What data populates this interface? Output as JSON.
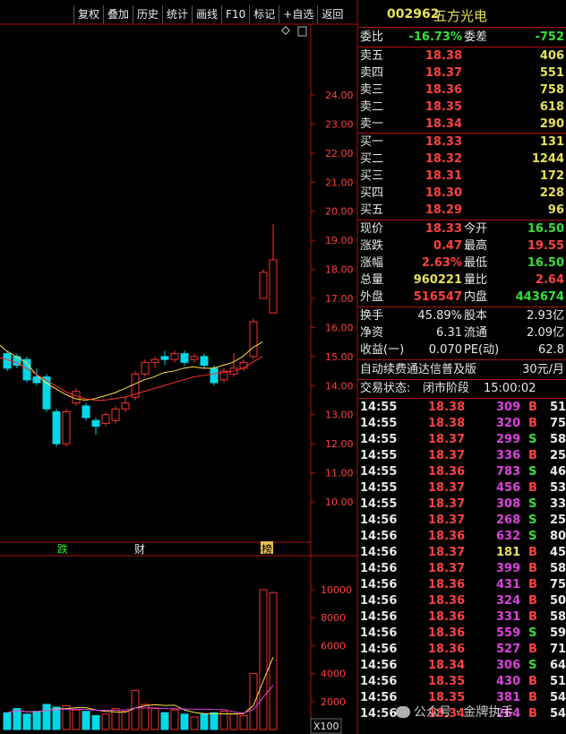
{
  "toolbar": {
    "buttons": [
      "复权",
      "叠加",
      "历史",
      "统计",
      "画线",
      "F10",
      "标记",
      "+自选",
      "返回"
    ]
  },
  "quote": {
    "code": "002962",
    "name": "五方光电",
    "weibi_label": "委比",
    "weibi_value": "-16.73%",
    "weicha_label": "委差",
    "weicha_value": "-752",
    "asks": [
      {
        "label": "卖五",
        "price": "18.38",
        "vol": "406"
      },
      {
        "label": "卖四",
        "price": "18.37",
        "vol": "551"
      },
      {
        "label": "卖三",
        "price": "18.36",
        "vol": "758"
      },
      {
        "label": "卖二",
        "price": "18.35",
        "vol": "618"
      },
      {
        "label": "卖一",
        "price": "18.34",
        "vol": "290"
      }
    ],
    "bids": [
      {
        "label": "买一",
        "price": "18.33",
        "vol": "131"
      },
      {
        "label": "买二",
        "price": "18.32",
        "vol": "1244"
      },
      {
        "label": "买三",
        "price": "18.31",
        "vol": "172"
      },
      {
        "label": "买四",
        "price": "18.30",
        "vol": "228"
      },
      {
        "label": "买五",
        "price": "18.29",
        "vol": "96"
      }
    ],
    "stats": [
      {
        "l1": "现价",
        "v1": "18.33",
        "c1": "red",
        "l2": "今开",
        "v2": "16.50",
        "c2": "green"
      },
      {
        "l1": "涨跌",
        "v1": "0.47",
        "c1": "red",
        "l2": "最高",
        "v2": "19.55",
        "c2": "red"
      },
      {
        "l1": "涨幅",
        "v1": "2.63%",
        "c1": "red",
        "l2": "最低",
        "v2": "16.50",
        "c2": "green"
      },
      {
        "l1": "总量",
        "v1": "960221",
        "c1": "yel",
        "l2": "量比",
        "v2": "2.64",
        "c2": "red"
      },
      {
        "l1": "外盘",
        "v1": "516547",
        "c1": "red",
        "l2": "内盘",
        "v2": "443674",
        "c2": "green"
      }
    ],
    "stats2": [
      {
        "l1": "换手",
        "v1": "45.89%",
        "l2": "股本",
        "v2": "2.93亿"
      },
      {
        "l1": "净资",
        "v1": "6.31",
        "l2": "流通",
        "v2": "2.09亿"
      },
      {
        "l1": "收益(一)",
        "v1": "0.070",
        "l2": "PE(动)",
        "v2": "62.8"
      }
    ],
    "promo": "自动续费通达信普及版",
    "promo_price": "30元/月",
    "status_label": "交易状态:",
    "status_value": "闭市阶段",
    "status_time": "15:00:02"
  },
  "ticks": [
    {
      "t": "14:55",
      "p": "18.38",
      "v": "309",
      "s": "B",
      "n": "51"
    },
    {
      "t": "14:55",
      "p": "18.38",
      "v": "320",
      "s": "B",
      "n": "75"
    },
    {
      "t": "14:55",
      "p": "18.37",
      "v": "299",
      "s": "S",
      "n": "58"
    },
    {
      "t": "14:55",
      "p": "18.37",
      "v": "336",
      "s": "B",
      "n": "25"
    },
    {
      "t": "14:55",
      "p": "18.36",
      "v": "783",
      "s": "S",
      "n": "46"
    },
    {
      "t": "14:55",
      "p": "18.37",
      "v": "456",
      "s": "B",
      "n": "53"
    },
    {
      "t": "14:55",
      "p": "18.37",
      "v": "308",
      "s": "S",
      "n": "33"
    },
    {
      "t": "14:56",
      "p": "18.37",
      "v": "268",
      "s": "S",
      "n": "25"
    },
    {
      "t": "14:56",
      "p": "18.36",
      "v": "632",
      "s": "S",
      "n": "80"
    },
    {
      "t": "14:56",
      "p": "18.37",
      "v": "181",
      "s": "B",
      "n": "45"
    },
    {
      "t": "14:56",
      "p": "18.37",
      "v": "399",
      "s": "B",
      "n": "58"
    },
    {
      "t": "14:56",
      "p": "18.36",
      "v": "431",
      "s": "B",
      "n": "75"
    },
    {
      "t": "14:56",
      "p": "18.36",
      "v": "324",
      "s": "B",
      "n": "50"
    },
    {
      "t": "14:56",
      "p": "18.36",
      "v": "331",
      "s": "B",
      "n": "58"
    },
    {
      "t": "14:56",
      "p": "18.36",
      "v": "559",
      "s": "S",
      "n": "59"
    },
    {
      "t": "14:56",
      "p": "18.36",
      "v": "527",
      "s": "B",
      "n": "71"
    },
    {
      "t": "14:56",
      "p": "18.34",
      "v": "306",
      "s": "S",
      "n": "64"
    },
    {
      "t": "14:56",
      "p": "18.35",
      "v": "430",
      "s": "B",
      "n": "51"
    },
    {
      "t": "14:56",
      "p": "18.35",
      "v": "381",
      "s": "B",
      "n": "54"
    },
    {
      "t": "14:56",
      "p": "18.34",
      "v": "264",
      "s": "B",
      "n": "54"
    }
  ],
  "price_axis": [
    "24.00",
    "23.00",
    "22.00",
    "21.00",
    "20.00",
    "19.00",
    "18.00",
    "17.00",
    "16.00",
    "15.00",
    "14.00",
    "13.00",
    "12.00",
    "11.00",
    "10.00"
  ],
  "vol_axis": [
    "10000",
    "8000",
    "6000",
    "4000",
    "2000"
  ],
  "vol_unit": "X100",
  "markers": [
    "跌",
    "财",
    "榜"
  ],
  "watermark": "公众号 · 金牌执手",
  "colors": {
    "up": "#ff3030",
    "down": "#00d8e8",
    "ma1": "#ffe24a",
    "ma2": "#ff3030",
    "grid": "#b01010"
  },
  "chart_data": {
    "type": "candlestick",
    "ylim": [
      9.5,
      25
    ],
    "candles": [
      {
        "o": 15.1,
        "c": 14.6,
        "h": 15.2,
        "l": 14.5
      },
      {
        "o": 15.0,
        "c": 14.7,
        "h": 15.1,
        "l": 14.6
      },
      {
        "o": 14.9,
        "c": 14.2,
        "h": 15.0,
        "l": 14.1
      },
      {
        "o": 14.3,
        "c": 14.1,
        "h": 14.6,
        "l": 14.0
      },
      {
        "o": 14.3,
        "c": 13.2,
        "h": 14.4,
        "l": 13.1
      },
      {
        "o": 13.1,
        "c": 12.0,
        "h": 13.2,
        "l": 11.9
      },
      {
        "o": 12.0,
        "c": 13.1,
        "h": 13.2,
        "l": 11.9
      },
      {
        "o": 13.4,
        "c": 13.8,
        "h": 13.9,
        "l": 13.3
      },
      {
        "o": 13.3,
        "c": 12.9,
        "h": 13.4,
        "l": 12.8
      },
      {
        "o": 12.8,
        "c": 12.6,
        "h": 12.9,
        "l": 12.3
      },
      {
        "o": 12.7,
        "c": 13.0,
        "h": 13.1,
        "l": 12.6
      },
      {
        "o": 12.8,
        "c": 13.2,
        "h": 13.3,
        "l": 12.7
      },
      {
        "o": 13.2,
        "c": 13.4,
        "h": 13.6,
        "l": 13.1
      },
      {
        "o": 13.6,
        "c": 14.4,
        "h": 14.5,
        "l": 13.5
      },
      {
        "o": 14.4,
        "c": 14.8,
        "h": 14.9,
        "l": 14.3
      },
      {
        "o": 14.8,
        "c": 14.9,
        "h": 15.0,
        "l": 14.6
      },
      {
        "o": 15.0,
        "c": 14.9,
        "h": 15.2,
        "l": 14.7
      },
      {
        "o": 14.9,
        "c": 15.1,
        "h": 15.2,
        "l": 14.8
      },
      {
        "o": 15.1,
        "c": 14.8,
        "h": 15.2,
        "l": 14.7
      },
      {
        "o": 14.9,
        "c": 15.0,
        "h": 15.1,
        "l": 14.8
      },
      {
        "o": 15.0,
        "c": 14.7,
        "h": 15.1,
        "l": 14.6
      },
      {
        "o": 14.6,
        "c": 14.1,
        "h": 14.7,
        "l": 14.0
      },
      {
        "o": 14.2,
        "c": 14.5,
        "h": 14.6,
        "l": 14.1
      },
      {
        "o": 14.4,
        "c": 14.6,
        "h": 15.1,
        "l": 14.3
      },
      {
        "o": 14.6,
        "c": 14.8,
        "h": 14.9,
        "l": 14.5
      },
      {
        "o": 15.0,
        "c": 16.2,
        "h": 16.3,
        "l": 14.9
      },
      {
        "o": 17.0,
        "c": 17.9,
        "h": 18.0,
        "l": 17.0
      },
      {
        "o": 16.5,
        "c": 18.33,
        "h": 19.55,
        "l": 16.5
      }
    ],
    "ma5": [
      15.5,
      15.2,
      15.0,
      14.8,
      14.4,
      14.1,
      13.9,
      13.7,
      13.55,
      13.5,
      13.55,
      13.65,
      13.75,
      13.9,
      14.05,
      14.2,
      14.3,
      14.45,
      14.5,
      14.6,
      14.65,
      14.6,
      14.6,
      14.7,
      14.8,
      15.0,
      15.3,
      15.5
    ],
    "ma10": [
      15.0,
      14.9,
      14.8,
      14.6,
      14.4,
      14.2,
      14.0,
      13.8,
      13.65,
      13.55,
      13.5,
      13.5,
      13.55,
      13.6,
      13.7,
      13.8,
      13.9,
      14.0,
      14.1,
      14.2,
      14.3,
      14.35,
      14.4,
      14.45,
      14.5,
      14.6,
      14.8,
      15.0
    ],
    "volumes": [
      1200,
      1500,
      1100,
      1300,
      1800,
      1600,
      1700,
      1400,
      1300,
      1000,
      1100,
      1500,
      1300,
      2800,
      1800,
      1500,
      1200,
      1400,
      1100,
      900,
      1100,
      1200,
      1300,
      1100,
      1000,
      4000,
      10000,
      9800
    ]
  }
}
